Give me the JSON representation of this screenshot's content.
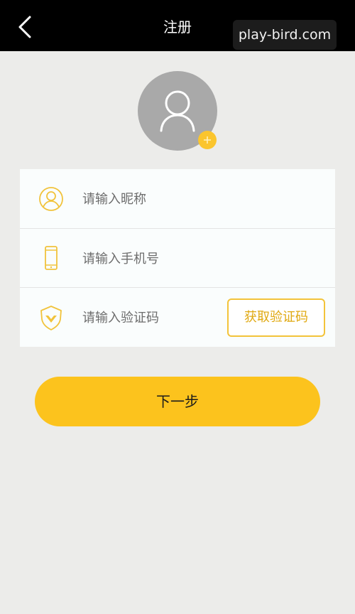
{
  "header": {
    "title": "注册",
    "watermark": "play-bird.com"
  },
  "icons": {
    "back": "chevron-left-icon",
    "avatar": "user-silhouette-icon",
    "avatar_add": "plus-icon",
    "nickname": "user-circle-icon",
    "phone": "phone-icon",
    "code": "shield-icon"
  },
  "form": {
    "nickname_placeholder": "请输入昵称",
    "phone_placeholder": "请输入手机号",
    "code_placeholder": "请输入验证码",
    "get_code_label": "获取验证码"
  },
  "actions": {
    "next_label": "下一步"
  },
  "colors": {
    "accent": "#fcc31d",
    "header": "#000000",
    "background": "#ececea",
    "avatar": "#a9a9a9"
  }
}
